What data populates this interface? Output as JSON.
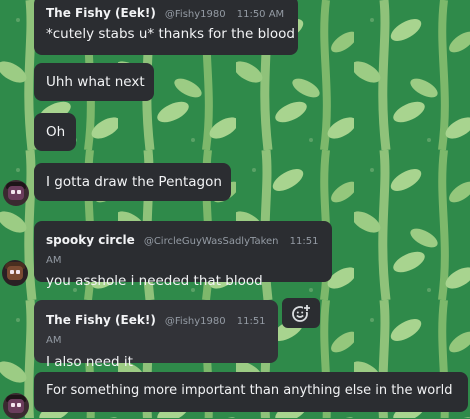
{
  "messages": [
    {
      "author": "The Fishy (Eek!)",
      "handle": "@Fishy1980",
      "time": "11:50 AM",
      "text": "*cutely stabs u* thanks for the blood"
    },
    {
      "text": "Uhh what next"
    },
    {
      "text": "Oh"
    },
    {
      "text": "I gotta draw the Pentagon"
    },
    {
      "author": "spooky circle",
      "handle": "@CircleGuyWasSadlyTaken",
      "time": "11:51 AM",
      "text": "you asshole i needed that blood"
    },
    {
      "author": "The Fishy (Eek!)",
      "handle": "@Fishy1980",
      "time": "11:51 AM",
      "text": "I also need it"
    },
    {
      "text": "For something more important than anything else in the world"
    }
  ],
  "icons": {
    "add_reaction": "add-reaction-icon"
  },
  "colors": {
    "bubble": "#2b2d31",
    "background": "#2f8a4a",
    "muted": "#949ba4"
  }
}
